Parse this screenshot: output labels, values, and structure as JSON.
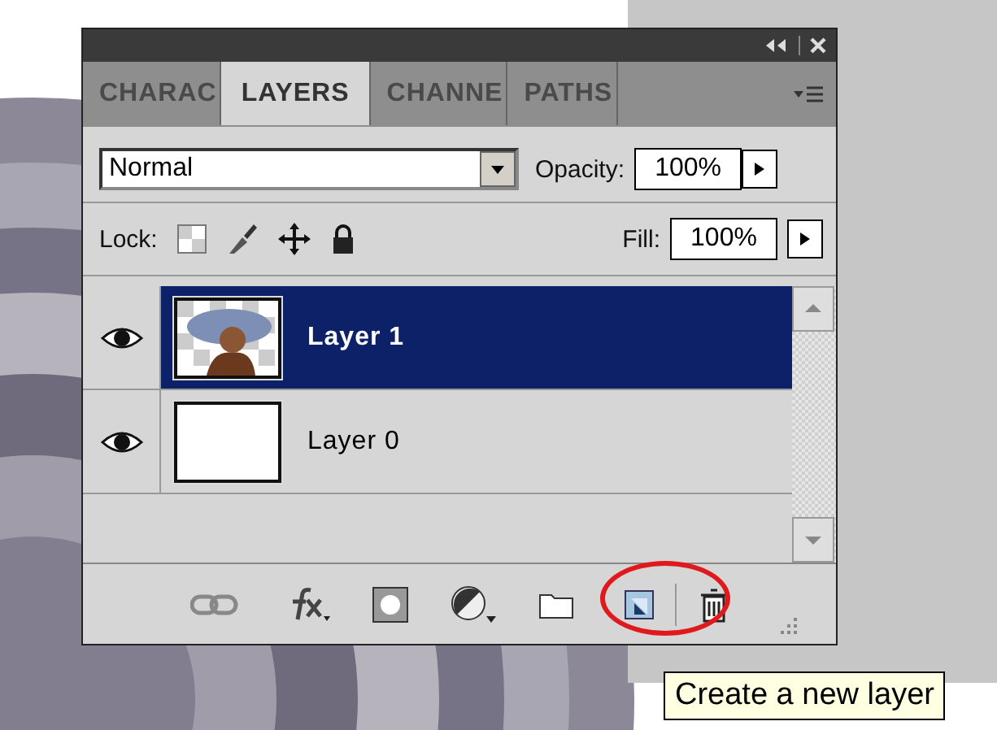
{
  "panel": {
    "tabs": [
      {
        "label": "CHARAC",
        "selected": false
      },
      {
        "label": "LAYERS",
        "selected": true
      },
      {
        "label": "CHANNE",
        "selected": false
      },
      {
        "label": "PATHS",
        "selected": false
      }
    ],
    "blend_mode": "Normal",
    "opacity_label": "Opacity:",
    "opacity": "100%",
    "lock_label": "Lock:",
    "fill_label": "Fill:",
    "fill": "100%",
    "layers": [
      {
        "name": "Layer 1",
        "selected": true,
        "visible": true,
        "kind": "picture"
      },
      {
        "name": "Layer 0",
        "selected": false,
        "visible": true,
        "kind": "blank"
      }
    ]
  },
  "tooltip": "Create a new layer"
}
